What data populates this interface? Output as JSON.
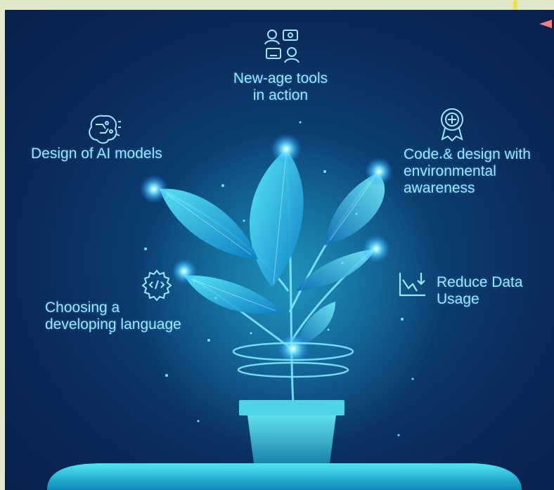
{
  "labels": {
    "new_age_tools": "New-age tools\nin action",
    "design_ai": "Design of AI models",
    "code_design": "Code & design with\nenvironmental\nawareness",
    "reduce_data": "Reduce Data\nUsage",
    "choosing_language": "Choosing a\ndeveloping language"
  },
  "icons": {
    "new_age_tools": "people-screens-icon",
    "design_ai": "brain-circuit-icon",
    "code_design": "leaf-badge-icon",
    "reduce_data": "chart-down-icon",
    "choosing_language": "code-gear-icon"
  },
  "colors": {
    "accent": "#9fe6ff",
    "background_page": "#dfe9c8",
    "background_dark": "#0a1f4b",
    "glow": "#2fd9ff"
  }
}
